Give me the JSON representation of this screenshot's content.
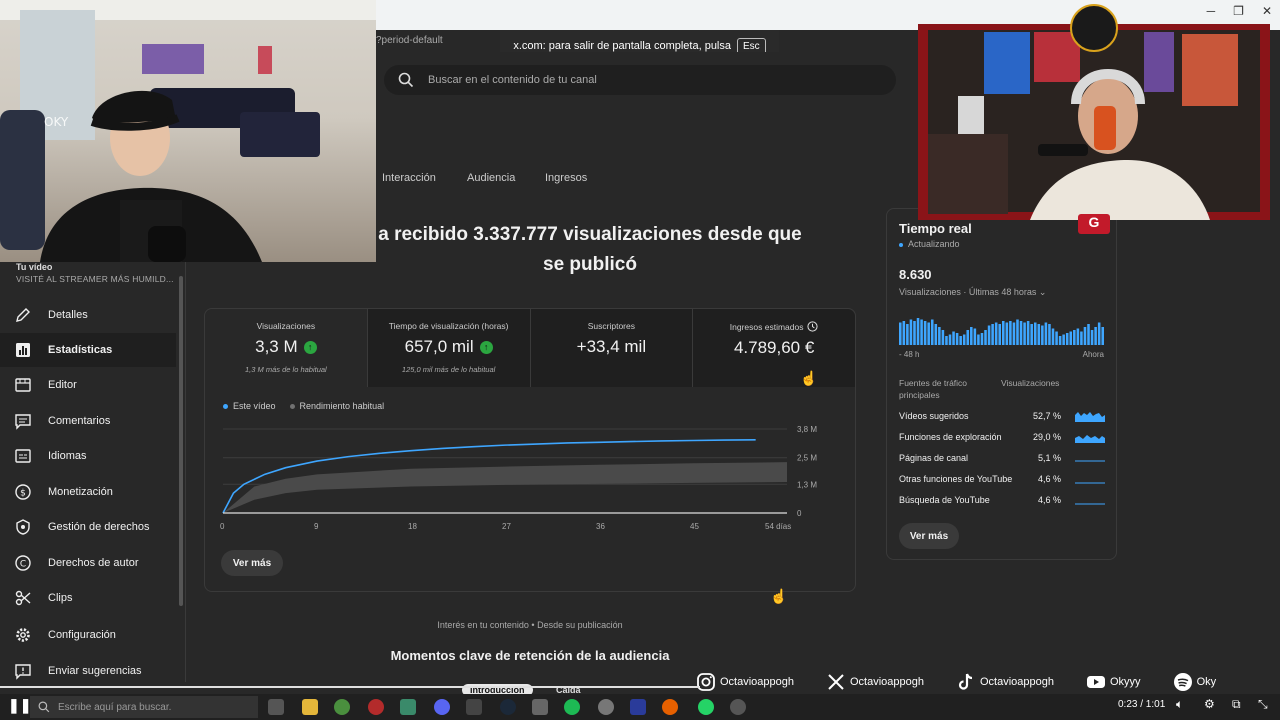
{
  "browser": {
    "url_fragment": "?period-default",
    "fullscreen_toast": "x.com: para salir de pantalla completa, pulsa",
    "esc_key": "Esc"
  },
  "search": {
    "placeholder": "Buscar en el contenido de tu canal"
  },
  "sidebar": {
    "video_label": "Tu vídeo",
    "video_title": "VISITÉ AL STREAMER MÁS HUMILD...",
    "items": [
      {
        "label": "Detalles",
        "icon": "pencil-icon"
      },
      {
        "label": "Estadísticas",
        "icon": "analytics-icon",
        "active": true
      },
      {
        "label": "Editor",
        "icon": "editor-icon"
      },
      {
        "label": "Comentarios",
        "icon": "comment-icon"
      },
      {
        "label": "Idiomas",
        "icon": "subtitles-icon"
      },
      {
        "label": "Monetización",
        "icon": "dollar-icon"
      },
      {
        "label": "Gestión de derechos",
        "icon": "rights-icon"
      },
      {
        "label": "Derechos de autor",
        "icon": "copyright-icon"
      },
      {
        "label": "Clips",
        "icon": "scissors-icon"
      },
      {
        "label": "Configuración",
        "icon": "gear-icon"
      },
      {
        "label": "Enviar sugerencias",
        "icon": "feedback-icon"
      }
    ]
  },
  "tabs": [
    "Interacción",
    "Audiencia",
    "Ingresos"
  ],
  "headline": {
    "line1": "a recibido 3.337.777 visualizaciones desde que",
    "line2": "se publicó"
  },
  "metrics": [
    {
      "label": "Visualizaciones",
      "value": "3,3 M",
      "note": "1,3 M más de lo habitual",
      "up": true
    },
    {
      "label": "Tiempo de visualización (horas)",
      "value": "657,0 mil",
      "note": "125,0 mil más de lo habitual",
      "up": true
    },
    {
      "label": "Suscriptores",
      "value": "+33,4 mil",
      "note": ""
    },
    {
      "label": "Ingresos estimados",
      "value": "4.789,60 €",
      "note": ""
    }
  ],
  "chart_data": {
    "type": "line",
    "x_unit": "días",
    "x_ticks": [
      "0",
      "9",
      "18",
      "27",
      "36",
      "45",
      "54 días"
    ],
    "y_ticks": [
      "0",
      "1,3 M",
      "2,5 M",
      "3,8 M"
    ],
    "ylim": [
      0,
      3.8
    ],
    "series": [
      {
        "name": "Este vídeo",
        "color": "#3ea6ff",
        "x": [
          0,
          1,
          2,
          4,
          6,
          9,
          12,
          15,
          18,
          21,
          24,
          27,
          30,
          33,
          36,
          39,
          42,
          45,
          48,
          51
        ],
        "y": [
          0,
          0.9,
          1.3,
          1.75,
          2.05,
          2.35,
          2.55,
          2.7,
          2.82,
          2.92,
          3.0,
          3.07,
          3.12,
          3.17,
          3.2,
          3.23,
          3.26,
          3.28,
          3.3,
          3.31
        ]
      },
      {
        "name": "Rendimiento habitual",
        "color": "#717171",
        "x": [
          0,
          3,
          6,
          9,
          18,
          27,
          36,
          45,
          54
        ],
        "y_low": [
          0,
          0.6,
          0.9,
          1.05,
          1.2,
          1.27,
          1.32,
          1.36,
          1.4
        ],
        "y_high": [
          0,
          1.2,
          1.55,
          1.75,
          2.0,
          2.1,
          2.18,
          2.25,
          2.3
        ]
      }
    ]
  },
  "card_button": "Ver más",
  "below": {
    "caption": "Interés en tu contenido • Desde su publicación",
    "title": "Momentos clave de retención de la audiencia",
    "tab_a": "Introducción",
    "tab_b": "Caída"
  },
  "realtime": {
    "title": "Tiempo real",
    "status": "Actualizando",
    "count": "8.630",
    "label": "Visualizaciones · Últimas 48 horas",
    "axis_left": "- 48 h",
    "axis_right": "Ahora",
    "bars": [
      0.75,
      0.8,
      0.7,
      0.85,
      0.8,
      0.9,
      0.85,
      0.8,
      0.75,
      0.85,
      0.7,
      0.6,
      0.5,
      0.3,
      0.35,
      0.45,
      0.4,
      0.3,
      0.35,
      0.5,
      0.6,
      0.55,
      0.35,
      0.4,
      0.5,
      0.65,
      0.7,
      0.75,
      0.7,
      0.8,
      0.75,
      0.8,
      0.75,
      0.85,
      0.8,
      0.75,
      0.8,
      0.7,
      0.75,
      0.7,
      0.65,
      0.75,
      0.7,
      0.55,
      0.45,
      0.3,
      0.35,
      0.4,
      0.45,
      0.5,
      0.55,
      0.45,
      0.6,
      0.7,
      0.5,
      0.6,
      0.75,
      0.6
    ],
    "sources_header": "Fuentes de tráfico principales",
    "views_header": "Visualizaciones",
    "sources": [
      {
        "name": "Vídeos sugeridos",
        "pct": "52,7 %"
      },
      {
        "name": "Funciones de exploración",
        "pct": "29,0 %"
      },
      {
        "name": "Páginas de canal",
        "pct": "5,1 %"
      },
      {
        "name": "Otras funciones de YouTube",
        "pct": "4,6 %"
      },
      {
        "name": "Búsqueda de YouTube",
        "pct": "4,6 %"
      }
    ],
    "button": "Ver más"
  },
  "cam_overlay": "OKY",
  "socials": [
    {
      "icon": "instagram-icon",
      "handle": "Octavioappogh"
    },
    {
      "icon": "x-icon",
      "handle": "Octavioappogh"
    },
    {
      "icon": "tiktok-icon",
      "handle": "Octavioappogh"
    },
    {
      "icon": "youtube-icon",
      "handle": "Okyyy"
    },
    {
      "icon": "spotify-icon",
      "handle": "Oky"
    }
  ],
  "taskbar": {
    "search_placeholder": "Escribe aquí para buscar.",
    "time": "0:23 / 1:01"
  },
  "colors": {
    "accent": "#3ea6ff",
    "up": "#2ba640",
    "background": "#282828"
  }
}
